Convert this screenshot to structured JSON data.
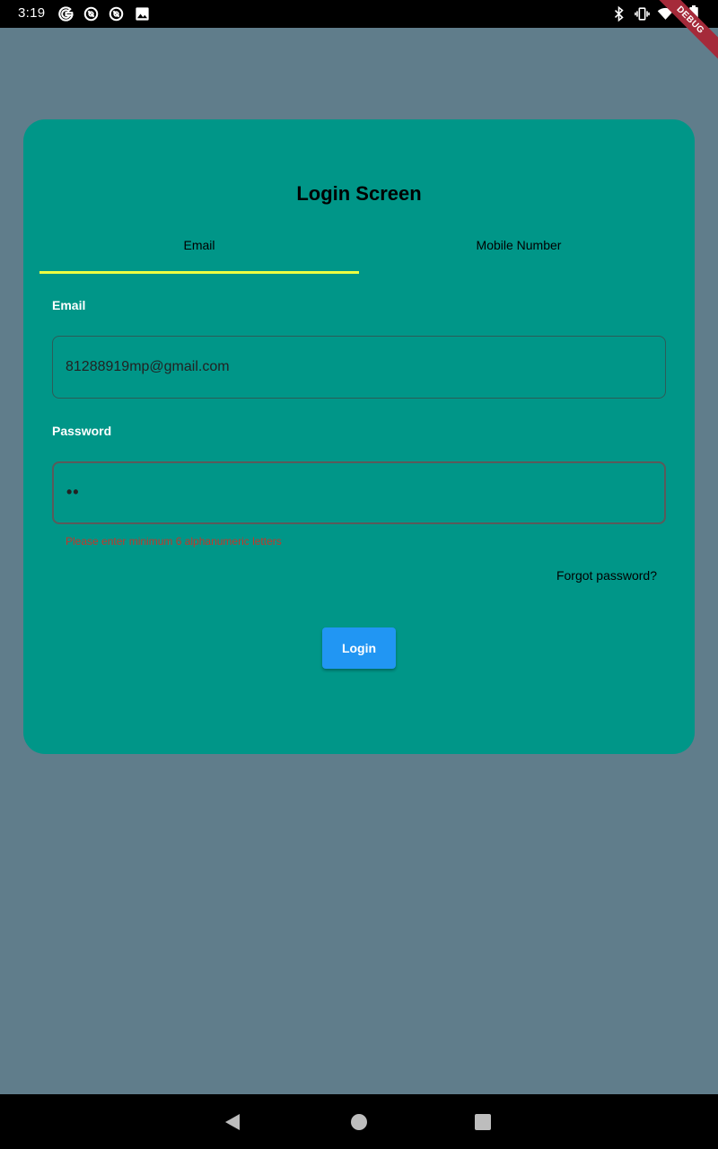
{
  "status_bar": {
    "time": "3:19",
    "left_icons": [
      "google-icon",
      "vpn-icon",
      "vpn-icon",
      "image-icon"
    ],
    "right_icons": [
      "bluetooth-icon",
      "vibrate-icon",
      "wifi-icon",
      "battery-icon"
    ],
    "debug_banner": "DEBUG"
  },
  "colors": {
    "background": "#607D8B",
    "card": "#009688",
    "tab_indicator": "#EEFF41",
    "login_button": "#2196F3",
    "error_text": "#C0392B"
  },
  "login_card": {
    "title": "Login Screen",
    "tabs": [
      {
        "label": "Email",
        "selected": true
      },
      {
        "label": "Mobile Number",
        "selected": false
      }
    ],
    "email_label": "Email",
    "email_value": "81288919mp@gmail.com",
    "password_label": "Password",
    "password_value": "••",
    "password_error": "Please enter minimum 6 alphanumeric letters",
    "forgot_password": "Forgot password?",
    "login_button": "Login"
  },
  "nav_bar": {
    "buttons": [
      "back-icon",
      "home-icon",
      "recents-icon"
    ]
  }
}
